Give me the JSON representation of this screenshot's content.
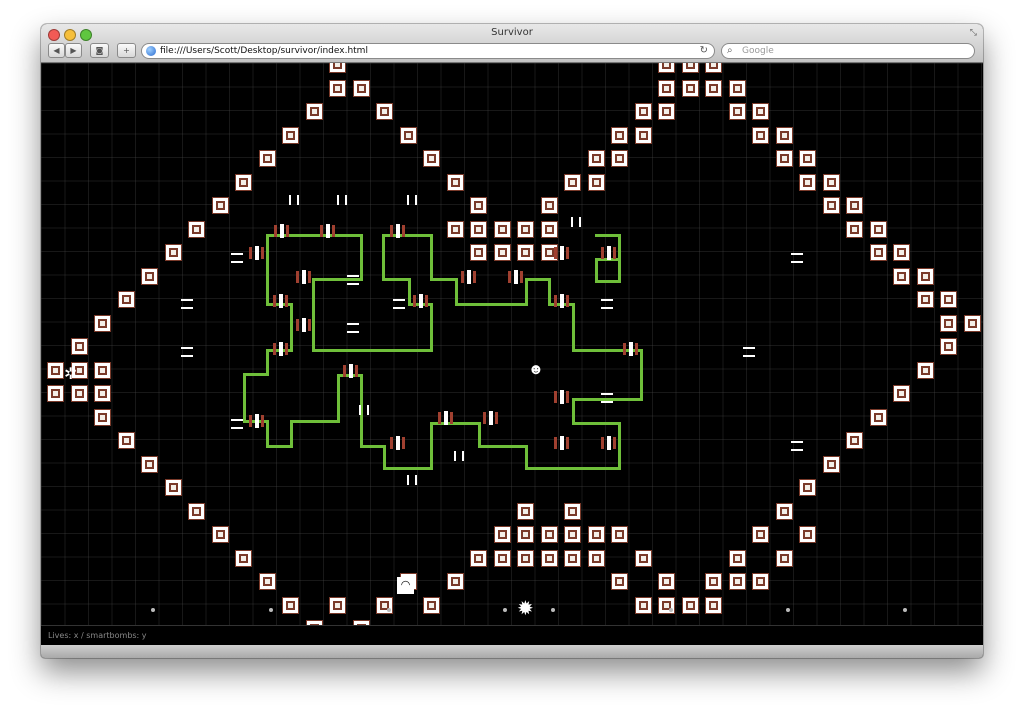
{
  "window": {
    "title": "Survivor",
    "resize_glyph": "⤡"
  },
  "toolbar": {
    "back": "◀",
    "forward": "▶",
    "share_icon": "eye-icon",
    "share": "◙",
    "add": "+",
    "url": "file:///Users/Scott/Desktop/survivor/index.html",
    "reload": "↻",
    "search_placeholder": "Google"
  },
  "status": "Lives: x / smartbombs: y",
  "colors": {
    "path": "#6fbf3a",
    "block_border": "#7a3a2a",
    "grid": "#464646",
    "background": "#000000"
  },
  "player": {
    "glyph": "☻"
  },
  "enemy_ship": {
    "glyph": "✲"
  },
  "bomb": {
    "glyph": "✹"
  },
  "spawner": {
    "glyph": "◠"
  }
}
